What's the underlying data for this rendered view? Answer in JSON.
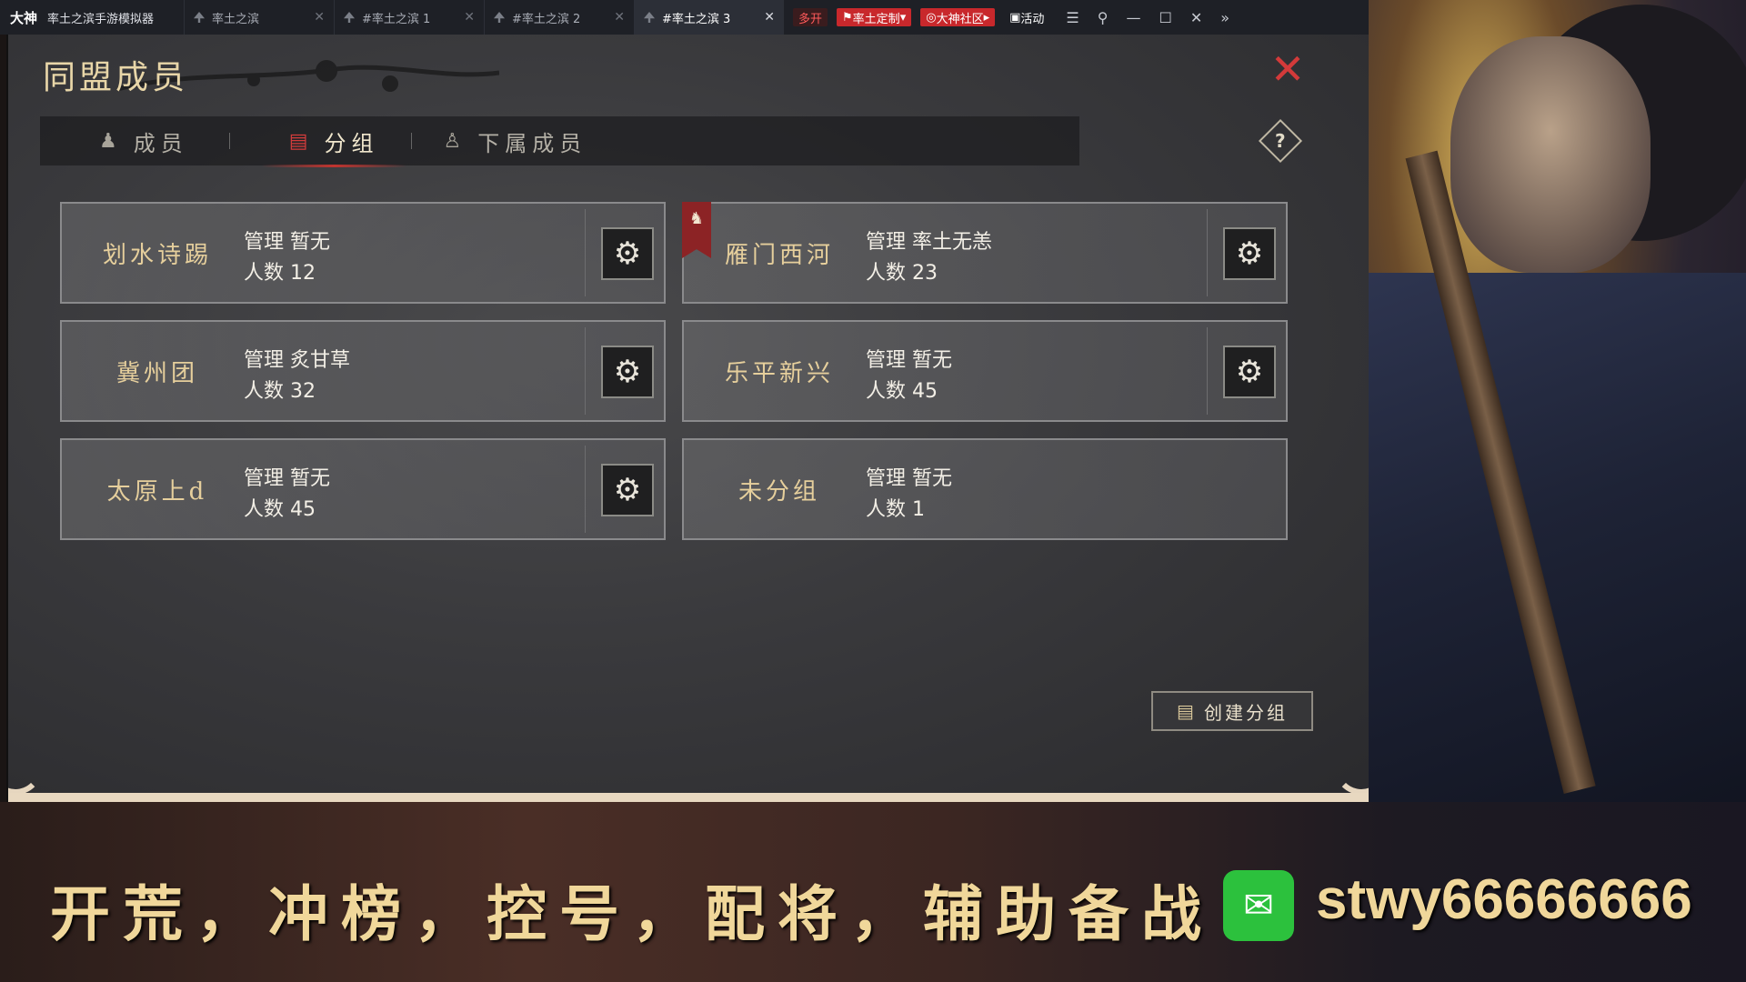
{
  "emulator": {
    "logo": "大神",
    "app_title": "率土之滨手游模拟器",
    "tabs": [
      {
        "label": "率土之滨",
        "active": false
      },
      {
        "label": "#率土之滨 1",
        "active": false
      },
      {
        "label": "#率土之滨 2",
        "active": false
      },
      {
        "label": "#率土之滨 3",
        "active": true
      }
    ],
    "badges": {
      "multi": "多开",
      "custom": "率土定制",
      "community": "大神社区",
      "activity": "活动"
    },
    "icons": [
      "menu-icon",
      "pin-icon",
      "minimize-icon",
      "maximize-icon",
      "close-icon",
      "expand-icon"
    ]
  },
  "panel": {
    "title": "同盟成员",
    "tabs": [
      {
        "label": "成员",
        "icon": "member-icon",
        "active": false
      },
      {
        "label": "分组",
        "icon": "group-icon",
        "active": true
      },
      {
        "label": "下属成员",
        "icon": "subordinate-icon",
        "active": false
      }
    ],
    "groups": [
      {
        "name": "划水诗踢",
        "manager_label": "管理",
        "manager": "暂无",
        "count_label": "人数",
        "count": "12",
        "has_settings": true,
        "flag": false
      },
      {
        "name": "雁门西河",
        "manager_label": "管理",
        "manager": "率土无恙",
        "count_label": "人数",
        "count": "23",
        "has_settings": true,
        "flag": true
      },
      {
        "name": "冀州团",
        "manager_label": "管理",
        "manager": "炙甘草",
        "count_label": "人数",
        "count": "32",
        "has_settings": true,
        "flag": false
      },
      {
        "name": "乐平新兴",
        "manager_label": "管理",
        "manager": "暂无",
        "count_label": "人数",
        "count": "45",
        "has_settings": true,
        "flag": false
      },
      {
        "name": "太原上d",
        "manager_label": "管理",
        "manager": "暂无",
        "count_label": "人数",
        "count": "45",
        "has_settings": true,
        "flag": false
      },
      {
        "name": "未分组",
        "manager_label": "管理",
        "manager": "暂无",
        "count_label": "人数",
        "count": "1",
        "has_settings": false,
        "flag": false
      }
    ],
    "create_button": "创建分组"
  },
  "banner": {
    "slogan": "开荒，冲榜，控号，配将，辅助备战",
    "contact": "stwy66666666"
  },
  "colors": {
    "accent_red": "#c0342f",
    "gold_text": "#e6cf9c",
    "wechat_green": "#2cc13d"
  }
}
